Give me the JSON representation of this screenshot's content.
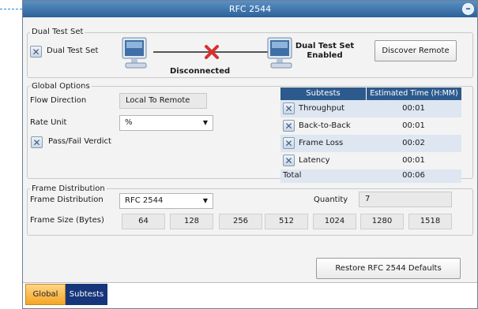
{
  "window": {
    "title": "RFC 2544"
  },
  "dual_test": {
    "group_label": "Dual Test Set",
    "checkbox_label": "Dual Test Set",
    "checkbox_mark": "✕",
    "connection_status": "Disconnected",
    "remote_status": "Dual Test Set\nEnabled",
    "discover_button": "Discover Remote"
  },
  "global_options": {
    "group_label": "Global Options",
    "flow_direction_label": "Flow Direction",
    "flow_direction_value": "Local To Remote",
    "rate_unit_label": "Rate Unit",
    "rate_unit_value": "%",
    "pass_fail_label": "Pass/Fail Verdict",
    "checkbox_mark": "✕"
  },
  "subtests_table": {
    "headers": [
      "Subtests",
      "Estimated Time (H:MM)"
    ],
    "rows": [
      {
        "name": "Throughput",
        "time": "00:01"
      },
      {
        "name": "Back-to-Back",
        "time": "00:01"
      },
      {
        "name": "Frame Loss",
        "time": "00:02"
      },
      {
        "name": "Latency",
        "time": "00:01"
      }
    ],
    "total_label": "Total",
    "total_time": "00:06",
    "checkbox_mark": "✕"
  },
  "frame_distribution": {
    "group_label": "Frame Distribution",
    "distribution_label": "Frame Distribution",
    "distribution_value": "RFC 2544",
    "quantity_label": "Quantity",
    "quantity_value": "7",
    "frame_size_label": "Frame Size (Bytes)",
    "frame_sizes": [
      "64",
      "128",
      "256",
      "512",
      "1024",
      "1280",
      "1518"
    ]
  },
  "restore_button": "Restore RFC 2544 Defaults",
  "tabs": [
    {
      "label": "Global",
      "active": true
    },
    {
      "label": "Subtests",
      "active": false
    }
  ],
  "colors": {
    "title_bar": "#2d6299",
    "table_header": "#2d5a8c",
    "active_tab": "#f5a623",
    "inactive_tab": "#16357a",
    "disconnect_x": "#d9302b"
  },
  "icons": [
    "close-icon",
    "computer-icon",
    "disconnect-x-icon",
    "checkbox-icon",
    "dropdown-arrow-icon"
  ]
}
